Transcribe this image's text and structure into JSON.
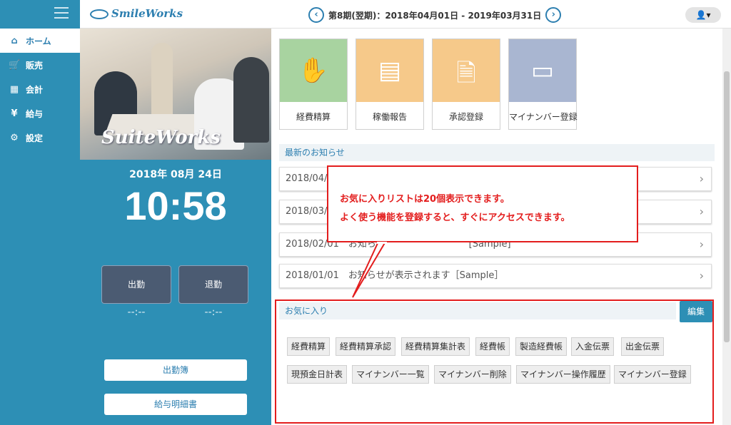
{
  "header": {
    "logo": "SmileWorks",
    "period": "第8期(翌期)：2018年04月01日 - 2019年03月31日",
    "prev_icon": "chevron-left-icon",
    "next_icon": "chevron-right-icon",
    "user_icon": "user-icon"
  },
  "sidebar": {
    "items": [
      {
        "label": "ホーム",
        "icon": "home-icon"
      },
      {
        "label": "販売",
        "icon": "cart-icon"
      },
      {
        "label": "会計",
        "icon": "calculator-icon"
      },
      {
        "label": "給与",
        "icon": "yen-bag-icon"
      },
      {
        "label": "設定",
        "icon": "gear-icon"
      }
    ]
  },
  "left": {
    "photo_logo": "SuiteWorks",
    "date": "2018年 08月 24日",
    "time": "10:58",
    "clock_in": "出勤",
    "clock_out": "退勤",
    "clock_in_time": "--:--",
    "clock_out_time": "--:--",
    "attendance_book": "出勤簿",
    "payslip": "給与明細書"
  },
  "tiles": [
    {
      "label": "経費精算",
      "color": "#a8d3a0"
    },
    {
      "label": "稼働報告",
      "color": "#f6c98a"
    },
    {
      "label": "承認登録",
      "color": "#f6c98a"
    },
    {
      "label": "マイナンバー登録",
      "color": "#a9b6d1"
    }
  ],
  "news": {
    "title": "最新のお知らせ",
    "items": [
      "2018/04/",
      "2018/03/",
      "2018/02/01　お知らせ　　　　　　　　　[Sample]",
      "2018/01/01　お知らせが表示されます［Sample］"
    ]
  },
  "favorites": {
    "title": "お気に入り",
    "edit": "編集",
    "chips": [
      "経費精算",
      "経費精算承認",
      "経費精算集計表",
      "経費帳",
      "製造経費帳",
      "入金伝票",
      "出金伝票",
      "現預金日計表",
      "マイナンバー一覧",
      "マイナンバー削除",
      "マイナンバー操作履歴",
      "マイナンバー登録"
    ]
  },
  "callout": {
    "line1": "お気に入りリストは20個表示できます。",
    "line2": "よく使う機能を登録すると、すぐにアクセスできます。"
  },
  "colors": {
    "sidebar": "#2d8fb5",
    "accent": "#2d7fb0",
    "callout_red": "#e31d1d"
  }
}
